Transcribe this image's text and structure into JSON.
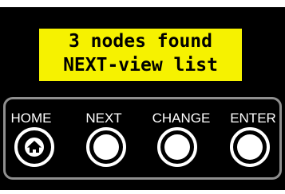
{
  "display": {
    "line1": "3 nodes found",
    "line2": "NEXT-view list"
  },
  "buttons": {
    "home": {
      "label": "HOME",
      "icon": "home-icon"
    },
    "next": {
      "label": "NEXT"
    },
    "change": {
      "label": "CHANGE"
    },
    "enter": {
      "label": "ENTER"
    }
  },
  "colors": {
    "lcd_background": "#f6f200",
    "device_background": "#000000",
    "panel_border": "#8f8f8f",
    "button_color": "#ffffff"
  }
}
